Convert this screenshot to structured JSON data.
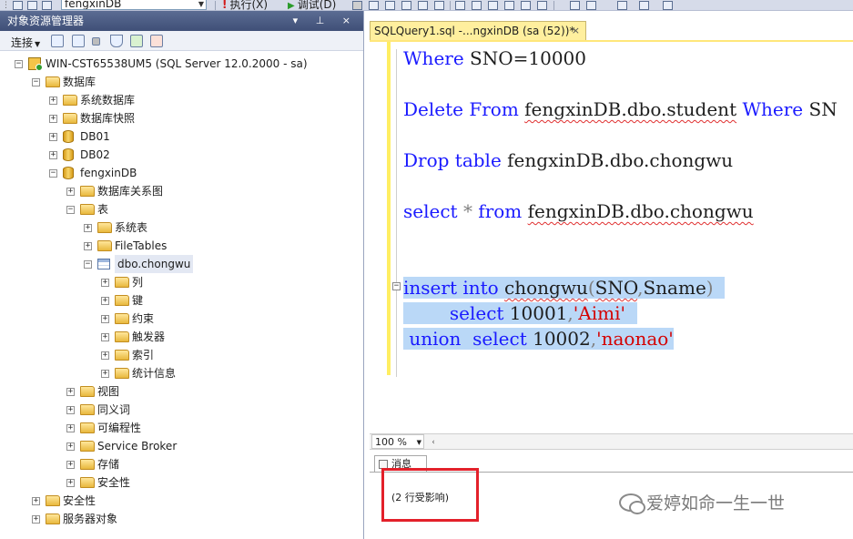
{
  "toolbar": {
    "database": "fengxinDB",
    "execute_label": "执行(X)",
    "debug_label": "调试(D)"
  },
  "object_explorer": {
    "title": "对象资源管理器",
    "title_controls": "▾ ⊥ ×",
    "connect_label": "连接",
    "tree": [
      {
        "label": "WIN-CST65538UM5 (SQL Server 12.0.2000 - sa)",
        "expander": "−",
        "icon": "server-icon"
      },
      {
        "label": "数据库",
        "expander": "−",
        "icon": "folder-icon"
      },
      {
        "label": "系统数据库",
        "expander": "+",
        "icon": "folder-icon"
      },
      {
        "label": "数据库快照",
        "expander": "+",
        "icon": "folder-icon"
      },
      {
        "label": "DB01",
        "expander": "+",
        "icon": "database-icon"
      },
      {
        "label": "DB02",
        "expander": "+",
        "icon": "database-icon"
      },
      {
        "label": "fengxinDB",
        "expander": "−",
        "icon": "database-icon"
      },
      {
        "label": "数据库关系图",
        "expander": "+",
        "icon": "folder-icon"
      },
      {
        "label": "表",
        "expander": "−",
        "icon": "folder-icon"
      },
      {
        "label": "系统表",
        "expander": "+",
        "icon": "folder-icon"
      },
      {
        "label": "FileTables",
        "expander": "+",
        "icon": "folder-icon"
      },
      {
        "label": "dbo.chongwu",
        "expander": "−",
        "icon": "table-icon"
      },
      {
        "label": "列",
        "expander": "+",
        "icon": "folder-icon"
      },
      {
        "label": "键",
        "expander": "+",
        "icon": "folder-icon"
      },
      {
        "label": "约束",
        "expander": "+",
        "icon": "folder-icon"
      },
      {
        "label": "触发器",
        "expander": "+",
        "icon": "folder-icon"
      },
      {
        "label": "索引",
        "expander": "+",
        "icon": "folder-icon"
      },
      {
        "label": "统计信息",
        "expander": "+",
        "icon": "folder-icon"
      },
      {
        "label": "视图",
        "expander": "+",
        "icon": "folder-icon"
      },
      {
        "label": "同义词",
        "expander": "+",
        "icon": "folder-icon"
      },
      {
        "label": "可编程性",
        "expander": "+",
        "icon": "folder-icon"
      },
      {
        "label": "Service Broker",
        "expander": "+",
        "icon": "folder-icon"
      },
      {
        "label": "存储",
        "expander": "+",
        "icon": "folder-icon"
      },
      {
        "label": "安全性",
        "expander": "+",
        "icon": "folder-icon"
      },
      {
        "label": "安全性",
        "expander": "+",
        "icon": "folder-icon"
      },
      {
        "label": "服务器对象",
        "expander": "+",
        "icon": "folder-icon"
      }
    ]
  },
  "editor": {
    "tab_title": "SQLQuery1.sql -...ngxinDB (sa (52))*",
    "tab_close": "×",
    "zoom": "100 %",
    "code": {
      "where1_kw": "Where",
      "where1_rest": " SNO=10000",
      "delete_kw": "Delete From",
      "delete_table": "fengxinDB.dbo.student",
      "delete_where_kw": "Where",
      "delete_tail": "SN",
      "drop_kw": "Drop table",
      "drop_table": "fengxinDB.dbo.chongwu",
      "select_kw": "select",
      "select_star": "*",
      "select_from": "from",
      "select_table": "fengxinDB.dbo.chongwu",
      "insert_kw": "insert into",
      "insert_table": "chongwu",
      "insert_paren_open": "(",
      "insert_col1": "SNO",
      "insert_comma": ",",
      "insert_col2": "Sname",
      "insert_paren_close": ")",
      "sel1_kw": "select",
      "sel1_num": " 10001",
      "sel1_comma": ",",
      "sel1_str": "'Aimi'",
      "union_kw": "union",
      "sel2_kw": "select",
      "sel2_num": " 10002",
      "sel2_comma": ",",
      "sel2_str": "'naonao'"
    }
  },
  "results": {
    "tab_label": "消息",
    "message": "(2 行受影响)"
  },
  "watermark": {
    "text": "爱婷如命一生一世"
  },
  "colors": {
    "keyword": "#1a1aff",
    "string": "#d40000",
    "selection": "#bad8f7",
    "highlight_box": "#e3202a"
  }
}
